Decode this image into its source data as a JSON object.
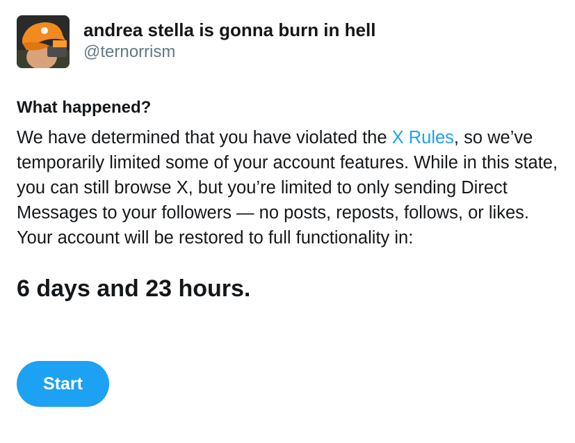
{
  "profile": {
    "display_name": "andrea stella is gonna burn in hell",
    "handle": "@ternorrism",
    "avatar_icon": "avatar-photo-orange-cap"
  },
  "notice": {
    "heading": "What happened?",
    "text_before_link": "We have determined that you have violated the ",
    "rules_link_label": "X Rules",
    "text_after_link": ", so we’ve temporarily limited some of your account features. While in this state, you can still browse X, but you’re limited to only sending Direct Messages to your followers — no posts, reposts, follows, or likes. Your account will be restored to full functionality in:",
    "countdown": "6 days and 23 hours."
  },
  "actions": {
    "start_label": "Start"
  },
  "colors": {
    "accent": "#1da1f2",
    "text": "#14171a",
    "muted": "#657786"
  }
}
